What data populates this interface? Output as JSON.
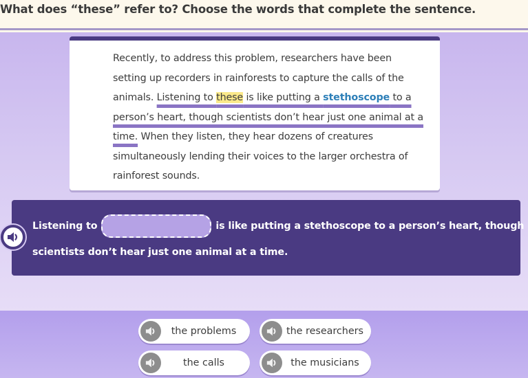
{
  "question": {
    "text": "What does “these” refer to? Choose the words that complete the sentence."
  },
  "passage": {
    "segments": [
      {
        "text": "Recently, to address this problem, researchers have been setting up recorders in rainforests to capture the calls of the animals. ",
        "style": "plain"
      },
      {
        "text": "Listening to ",
        "style": "underline"
      },
      {
        "text": "these",
        "style": "underline-highlight"
      },
      {
        "text": " is like putting a ",
        "style": "underline"
      },
      {
        "text": "stethoscope",
        "style": "underline-vocab"
      },
      {
        "text": " to a person’s heart, though scientists don’t hear just one animal at a time.",
        "style": "underline"
      },
      {
        "text": " When they listen, they hear dozens of creatures simultaneously lending their voices to the larger orchestra of rainforest sounds.",
        "style": "plain"
      }
    ]
  },
  "sentence": {
    "before_blank": "Listening to",
    "after_blank": "is like putting a stethoscope to a person’s heart, though",
    "line2": "scientists don’t hear just one animal at a time.",
    "audio_icon": "speaker-icon"
  },
  "choices": [
    {
      "label": "the problems",
      "icon": "speaker-icon"
    },
    {
      "label": "the researchers",
      "icon": "speaker-icon"
    },
    {
      "label": "the calls",
      "icon": "speaker-icon"
    },
    {
      "label": "the musicians",
      "icon": "speaker-icon"
    }
  ],
  "colors": {
    "accent_dark": "#4a3a82",
    "underline": "#8a74c4",
    "highlight": "#fbe98a",
    "vocab": "#2d7fb8"
  }
}
